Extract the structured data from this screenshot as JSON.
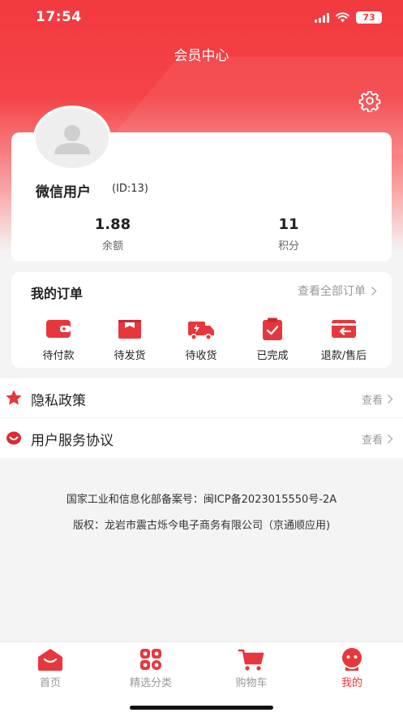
{
  "status_bar": {
    "time": "17:54",
    "battery": "73"
  },
  "header": {
    "title": "会员中心",
    "settings_icon": "gear-icon"
  },
  "profile": {
    "avatar_icon": "user-avatar-icon",
    "name": "微信用户",
    "id_text": "(ID:13)",
    "balance_value": "1.88",
    "balance_label": "余额",
    "points_value": "11",
    "points_label": "积分"
  },
  "orders": {
    "title": "我的订单",
    "view_all": "查看全部订单",
    "items": [
      {
        "label": "待付款",
        "icon": "wallet-icon"
      },
      {
        "label": "待发货",
        "icon": "package-icon"
      },
      {
        "label": "待收货",
        "icon": "truck-icon"
      },
      {
        "label": "已完成",
        "icon": "clipboard-check-icon"
      },
      {
        "label": "退款/售后",
        "icon": "refund-card-icon"
      }
    ]
  },
  "menu": [
    {
      "label": "隐私政策",
      "action": "查看",
      "icon": "star-icon"
    },
    {
      "label": "用户服务协议",
      "action": "查看",
      "icon": "smile-badge-icon"
    }
  ],
  "footer": {
    "icp": "国家工业和信息化部备案号：闽ICP备2023015550号-2A",
    "copyright": "版权：龙岩市震古烁今电子商务有限公司（京通顺应用)"
  },
  "tabbar": {
    "items": [
      {
        "label": "首页",
        "icon": "home-icon",
        "active": false
      },
      {
        "label": "精选分类",
        "icon": "category-icon",
        "active": false
      },
      {
        "label": "购物车",
        "icon": "cart-icon",
        "active": false
      },
      {
        "label": "我的",
        "icon": "profile-icon",
        "active": true
      }
    ]
  },
  "colors": {
    "primary": "#f0323a",
    "muted": "#999999",
    "background": "#f4f4f4"
  }
}
